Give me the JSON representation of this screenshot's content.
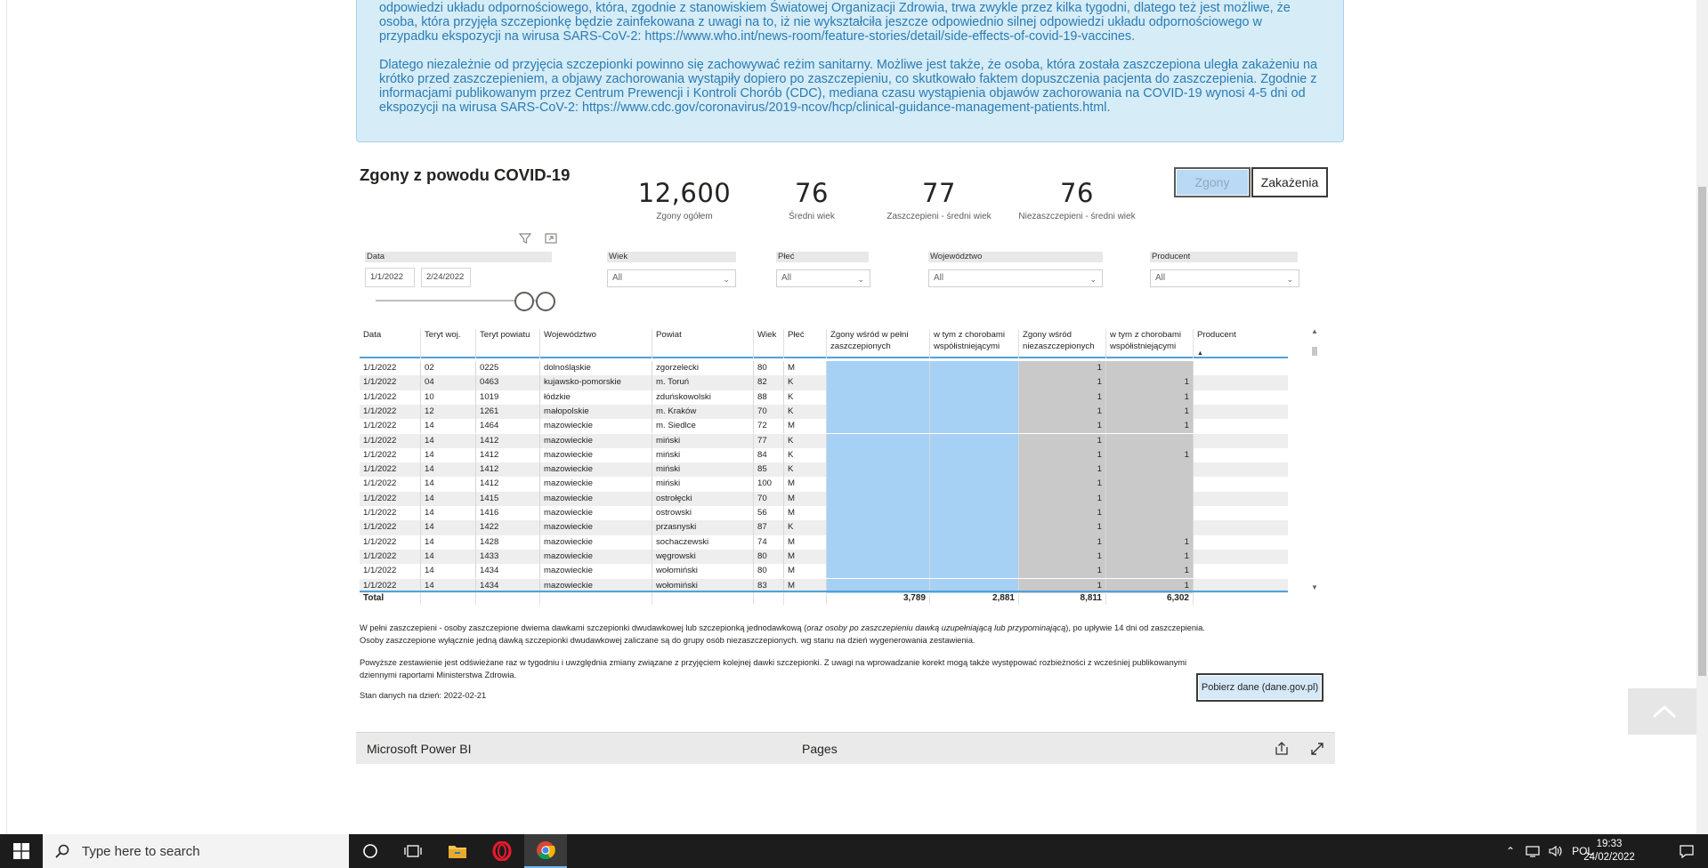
{
  "info": {
    "paragraph1": "odpowiedzi układu odpornościowego, która, zgodnie z stanowiskiem Światowej Organizacji Zdrowia, trwa zwykle przez kilka tygodni, dlatego też jest możliwe, że osoba, która przyjęła szczepionkę będzie zainfekowana z uwagi na to, iż nie wykształciła jeszcze odpowiednio silnej odpowiedzi układu odpornościowego w przypadku ekspozycji na wirusa SARS-CoV-2: https://www.who.int/news-room/feature-stories/detail/side-effects-of-covid-19-vaccines.",
    "paragraph2": "Dlatego niezależnie od przyjęcia szczepionki powinno się zachowywać reżim sanitarny. Możliwe jest także, że osoba, która została zaszczepiona uległa zakażeniu na krótko przed zaszczepieniem, a objawy zachorowania wystąpiły dopiero po zaszczepieniu, co skutkowało faktem dopuszczenia pacjenta do zaszczepienia. Zgodnie z informacjami publikowanym przez Centrum Prewencji i Kontroli Chorób (CDC), mediana czasu wystąpienia objawów zachorowania na COVID-19 wynosi 4-5 dni od ekspozycji na wirusa SARS-CoV-2: https://www.cdc.gov/coronavirus/2019-ncov/hcp/clinical-guidance-management-patients.html."
  },
  "report": {
    "title": "Zgony z powodu COVID-19",
    "kpis": [
      {
        "value": "12,600",
        "label": "Zgony ogółem"
      },
      {
        "value": "76",
        "label": "Średni wiek"
      },
      {
        "value": "77",
        "label": "Zaszczepieni - średni wiek"
      },
      {
        "value": "76",
        "label": "Niezaszczepieni - średni wiek"
      }
    ],
    "tabs": {
      "deaths": "Zgony",
      "infections": "Zakażenia"
    },
    "filters": {
      "date_label": "Data",
      "date_from": "1/1/2022",
      "date_to": "2/24/2022",
      "age_label": "Wiek",
      "age_value": "All",
      "sex_label": "Płeć",
      "sex_value": "All",
      "voiv_label": "Województwo",
      "voiv_value": "All",
      "producer_label": "Producent",
      "producer_value": "All"
    }
  },
  "table": {
    "headers": {
      "date": "Data",
      "teryt_woj": "Teryt woj.",
      "teryt_pow": "Teryt powiatu",
      "voiv": "Województwo",
      "powiat": "Powiat",
      "age": "Wiek",
      "sex": "Płeć",
      "vacc_line1": "Zgony wśród w pełni",
      "vacc_line2": "zaszczepionych",
      "vacc_com_line1": "w tym z chorobami",
      "vacc_com_line2": "współistniejącymi",
      "unvacc_line1": "Zgony wśród",
      "unvacc_line2": "niezaszczepionych",
      "unvacc_com_line1": "w tym z chorobami",
      "unvacc_com_line2": "współistniejącymi",
      "producer": "Producent"
    },
    "rows": [
      {
        "date": "1/1/2022",
        "tw": "02",
        "tp": "0225",
        "woj": "dolnośląskie",
        "pow": "zgorzelecki",
        "age": "80",
        "sex": "M",
        "u": "1",
        "uc": ""
      },
      {
        "date": "1/1/2022",
        "tw": "04",
        "tp": "0463",
        "woj": "kujawsko-pomorskie",
        "pow": "m. Toruń",
        "age": "82",
        "sex": "K",
        "u": "1",
        "uc": "1"
      },
      {
        "date": "1/1/2022",
        "tw": "10",
        "tp": "1019",
        "woj": "łódzkie",
        "pow": "zduńskowolski",
        "age": "88",
        "sex": "K",
        "u": "1",
        "uc": "1"
      },
      {
        "date": "1/1/2022",
        "tw": "12",
        "tp": "1261",
        "woj": "małopolskie",
        "pow": "m. Kraków",
        "age": "70",
        "sex": "K",
        "u": "1",
        "uc": "1"
      },
      {
        "date": "1/1/2022",
        "tw": "14",
        "tp": "1464",
        "woj": "mazowieckie",
        "pow": "m. Siedlce",
        "age": "72",
        "sex": "M",
        "u": "1",
        "uc": "1"
      },
      {
        "date": "1/1/2022",
        "tw": "14",
        "tp": "1412",
        "woj": "mazowieckie",
        "pow": "miński",
        "age": "77",
        "sex": "K",
        "u": "1",
        "uc": ""
      },
      {
        "date": "1/1/2022",
        "tw": "14",
        "tp": "1412",
        "woj": "mazowieckie",
        "pow": "miński",
        "age": "84",
        "sex": "K",
        "u": "1",
        "uc": "1"
      },
      {
        "date": "1/1/2022",
        "tw": "14",
        "tp": "1412",
        "woj": "mazowieckie",
        "pow": "miński",
        "age": "85",
        "sex": "K",
        "u": "1",
        "uc": ""
      },
      {
        "date": "1/1/2022",
        "tw": "14",
        "tp": "1412",
        "woj": "mazowieckie",
        "pow": "miński",
        "age": "100",
        "sex": "M",
        "u": "1",
        "uc": ""
      },
      {
        "date": "1/1/2022",
        "tw": "14",
        "tp": "1415",
        "woj": "mazowieckie",
        "pow": "ostrołęcki",
        "age": "70",
        "sex": "M",
        "u": "1",
        "uc": ""
      },
      {
        "date": "1/1/2022",
        "tw": "14",
        "tp": "1416",
        "woj": "mazowieckie",
        "pow": "ostrowski",
        "age": "56",
        "sex": "M",
        "u": "1",
        "uc": ""
      },
      {
        "date": "1/1/2022",
        "tw": "14",
        "tp": "1422",
        "woj": "mazowieckie",
        "pow": "przasnyski",
        "age": "87",
        "sex": "K",
        "u": "1",
        "uc": ""
      },
      {
        "date": "1/1/2022",
        "tw": "14",
        "tp": "1428",
        "woj": "mazowieckie",
        "pow": "sochaczewski",
        "age": "74",
        "sex": "M",
        "u": "1",
        "uc": "1"
      },
      {
        "date": "1/1/2022",
        "tw": "14",
        "tp": "1433",
        "woj": "mazowieckie",
        "pow": "węgrowski",
        "age": "80",
        "sex": "M",
        "u": "1",
        "uc": "1"
      },
      {
        "date": "1/1/2022",
        "tw": "14",
        "tp": "1434",
        "woj": "mazowieckie",
        "pow": "wołomiński",
        "age": "80",
        "sex": "M",
        "u": "1",
        "uc": "1"
      },
      {
        "date": "1/1/2022",
        "tw": "14",
        "tp": "1434",
        "woj": "mazowieckie",
        "pow": "wołomiński",
        "age": "83",
        "sex": "M",
        "u": "1",
        "uc": "1"
      }
    ],
    "total": {
      "label": "Total",
      "vacc": "3,789",
      "vacc_com": "2,881",
      "unvacc": "8,811",
      "unvacc_com": "6,302"
    }
  },
  "notes": {
    "line1_a": "W pełni zaszczepieni - osoby zaszczepione dwiema dawkami szczepionki dwudawkowej lub szczepionką jednodawkową (",
    "line1_italic": "oraz osoby po zaszczepieniu dawką uzupełniającą lub przypominającą",
    "line1_b": "), po upływie 14 dni od zaszczepienia.",
    "line2": "Osoby zaszczepione wyłącznie jedną dawką szczepionki dwudawkowej zaliczane są do grupy osób niezaszczepionych. wg stanu na dzień wygenerowania zestawienia.",
    "line3": "Powyższe zestawienie jest odświeżane raz w tygodniu i uwzględnia zmiany związane z przyjęciem kolejnej dawki szczepionki. Z uwagi na wprowadzanie korekt mogą także występować rozbieżności z wcześniej publikowanymi",
    "line4": "dziennymi raportami Ministerstwa Zdrowia.",
    "line5": "Stan danych na dzień: 2022-02-21"
  },
  "download_button": "Pobierz dane (dane.gov.pl)",
  "pbi_bar": {
    "brand": "Microsoft Power BI",
    "pages": "Pages"
  },
  "taskbar": {
    "search_placeholder": "Type here to search",
    "language": "POL",
    "time": "19:33",
    "date": "24/02/2022"
  },
  "colors": {
    "vacc_col": "#a7d0f5",
    "unvacc_col": "#c9c9c9",
    "link_text": "#2a7cb5"
  }
}
